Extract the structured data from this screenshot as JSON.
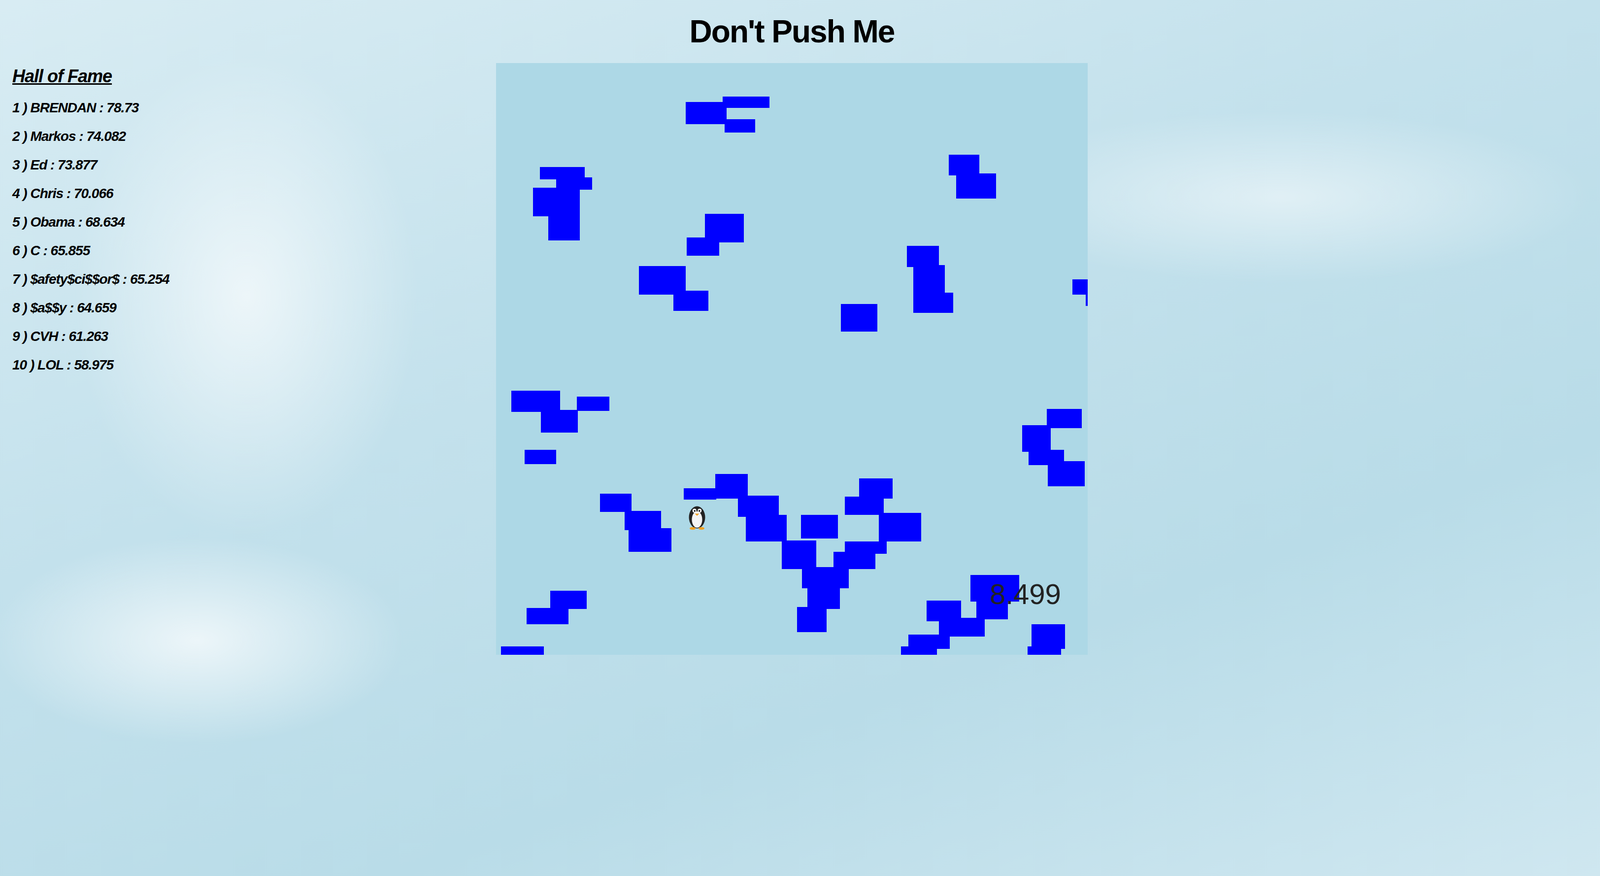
{
  "title": "Don't Push Me",
  "hall_of_fame": {
    "heading": "Hall of Fame",
    "entries": [
      "1 ) BRENDAN : 78.73",
      "2 ) Markos : 74.082",
      "3 ) Ed : 73.877",
      "4 ) Chris : 70.066",
      "5 ) Obama : 68.634",
      "6 ) C : 65.855",
      "7 ) $afety$ci$$or$ : 65.254",
      "8 ) $a$$y : 64.659",
      "9 ) CVH : 61.263",
      "10 ) LOL : 58.975"
    ]
  },
  "timer": "8.499"
}
